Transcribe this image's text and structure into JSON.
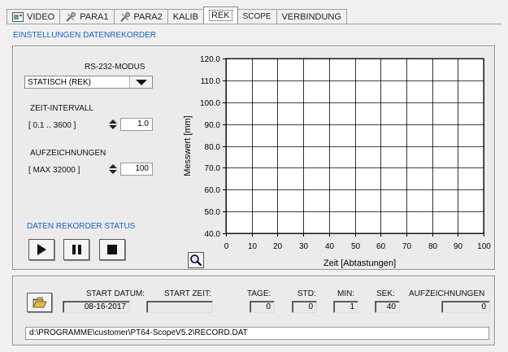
{
  "tabs": [
    {
      "label": "VIDEO",
      "icon": "video-icon"
    },
    {
      "label": "PARA1",
      "icon": "tools-icon"
    },
    {
      "label": "PARA2",
      "icon": "tools-icon"
    },
    {
      "label": "KALIB"
    },
    {
      "label": "REK",
      "active": true
    },
    {
      "label": "SCOPE"
    },
    {
      "label": "VERBINDUNG"
    }
  ],
  "section_title": "EINSTELLUNGEN DATENREKORDER",
  "settings": {
    "rs232_label": "RS-232-MODUS",
    "rs232_value": "STATISCH (REK)",
    "interval_label": "ZEIT-INTERVALL",
    "interval_range": "[ 0.1 .. 3600 ]",
    "interval_value": "1.0",
    "records_label": "AUFZEICHNUNGEN",
    "records_range": "[ MAX 32000 ]",
    "records_value": "100"
  },
  "status_title": "DATEN REKORDER STATUS",
  "chart_data": {
    "type": "line",
    "xlabel": "Zeit [Abtastungen]",
    "ylabel": "Messwert [mm]",
    "xlim": [
      0,
      100
    ],
    "ylim": [
      40,
      120
    ],
    "x_ticks": [
      "0",
      "10",
      "20",
      "30",
      "40",
      "50",
      "60",
      "70",
      "80",
      "90",
      "100"
    ],
    "y_ticks": [
      "40.0",
      "50.0",
      "60.0",
      "70.0",
      "80.0",
      "90.0",
      "100.0",
      "110.0",
      "120.0"
    ],
    "grid": true,
    "series": []
  },
  "record_info": {
    "start_date_label": "START DATUM:",
    "start_date": "08-16-2017",
    "start_time_label": "START ZEIT:",
    "start_time": "",
    "days_label": "TAGE:",
    "days": "0",
    "hours_label": "STD:",
    "hours": "0",
    "minutes_label": "MIN:",
    "minutes": "1",
    "seconds_label": "SEK:",
    "seconds": "40",
    "records_label": "AUFZEICHNUNGEN",
    "records": "0"
  },
  "file_path": "d:\\PROGRAMME\\customer\\PT64-ScopeV5.2\\RECORD.DAT",
  "colors": {
    "accent": "#1a5fd0",
    "plot_bg": "#ffffff",
    "grid": "#000000"
  }
}
